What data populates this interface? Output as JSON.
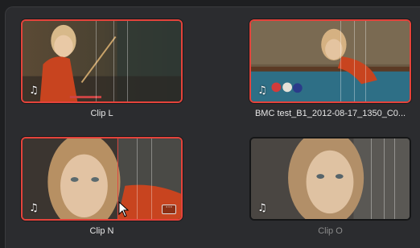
{
  "clips": [
    {
      "name": "Clip L",
      "selected": true
    },
    {
      "name": "BMC test_B1_2012-08-17_1350_C0...",
      "selected": true
    },
    {
      "name": "Clip N",
      "selected": true
    },
    {
      "name": "Clip O",
      "selected": false
    }
  ],
  "icons": {
    "audio": "♫",
    "more": "···"
  },
  "colors": {
    "selection": "#e4433b",
    "panel": "#2b2c2f"
  }
}
